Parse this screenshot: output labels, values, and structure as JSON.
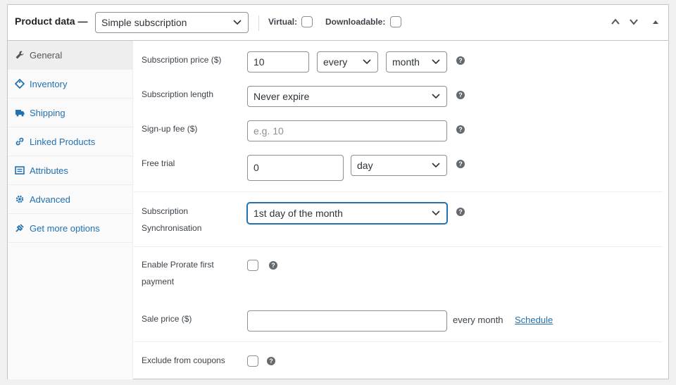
{
  "header": {
    "title": "Product data —",
    "product_type": "Simple subscription",
    "virtual_label": "Virtual:",
    "downloadable_label": "Downloadable:"
  },
  "tabs": [
    {
      "label": "General",
      "icon": "wrench-icon",
      "active": true
    },
    {
      "label": "Inventory",
      "icon": "tag-icon"
    },
    {
      "label": "Shipping",
      "icon": "truck-icon"
    },
    {
      "label": "Linked Products",
      "icon": "link-icon"
    },
    {
      "label": "Attributes",
      "icon": "list-icon"
    },
    {
      "label": "Advanced",
      "icon": "gear-icon"
    },
    {
      "label": "Get more options",
      "icon": "plugin-icon"
    }
  ],
  "fields": {
    "price": {
      "label": "Subscription price ($)",
      "value": "10",
      "interval": "every",
      "period": "month"
    },
    "length": {
      "label": "Subscription length",
      "value": "Never expire"
    },
    "signup_fee": {
      "label": "Sign-up fee ($)",
      "placeholder": "e.g. 10"
    },
    "trial": {
      "label": "Free trial",
      "value": "0",
      "period": "day"
    },
    "sync": {
      "label_line1": "Subscription",
      "label_line2": "Synchronisation",
      "value": "1st day of the month"
    },
    "prorate": {
      "label_line1": "Enable Prorate first",
      "label_line2": "payment"
    },
    "sale": {
      "label": "Sale price ($)",
      "suffix": "every month",
      "schedule": "Schedule"
    },
    "coupons": {
      "label": "Exclude from coupons"
    }
  },
  "help_glyph": "?"
}
